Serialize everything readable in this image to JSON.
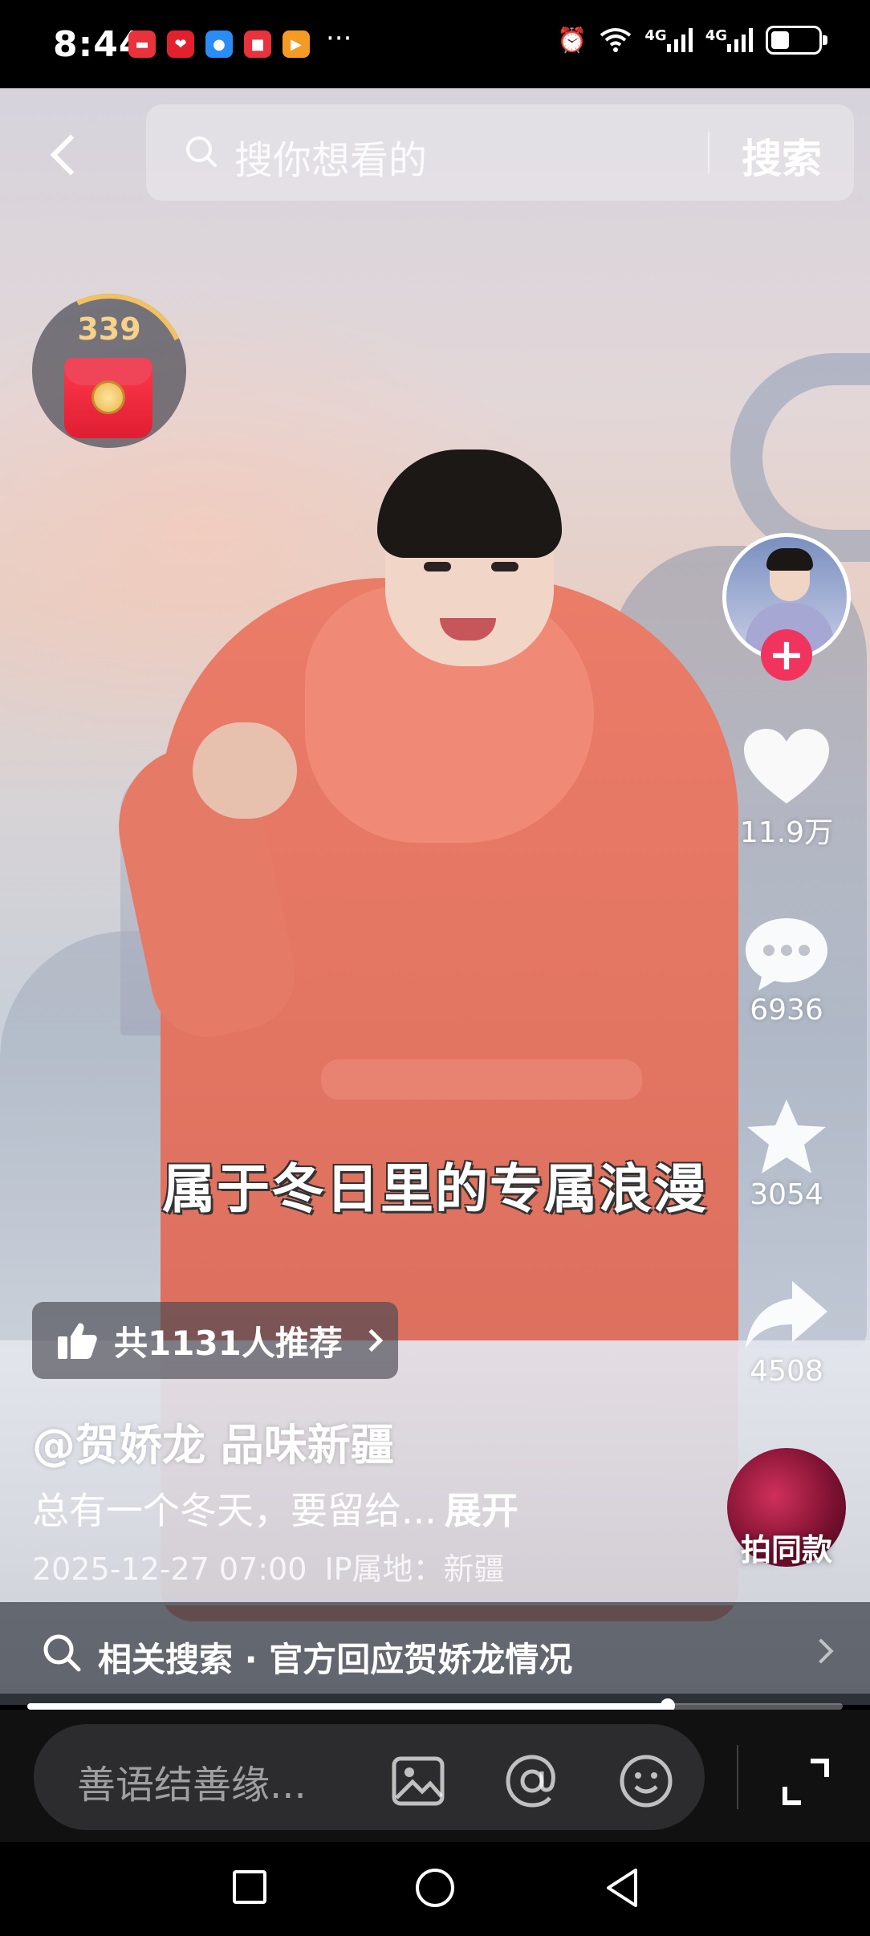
{
  "status_bar": {
    "time": "8:44",
    "notifications": [
      {
        "name": "huawei-app-icon",
        "color": "#e8323c",
        "glyph": "▬"
      },
      {
        "name": "heart-app-icon",
        "color": "#e3202d",
        "glyph": "❤"
      },
      {
        "name": "message-app-icon",
        "color": "#2a8cf5",
        "glyph": "●"
      },
      {
        "name": "red-app-icon",
        "color": "#e8323c",
        "glyph": "■"
      },
      {
        "name": "play-app-icon",
        "color": "#f59a23",
        "glyph": "▶"
      }
    ],
    "more": "···",
    "network_4g_1": "4G",
    "network_4g_2": "4G"
  },
  "search": {
    "placeholder": "搜你想看的",
    "button_label": "搜索"
  },
  "red_packet": {
    "count": "339"
  },
  "actions": {
    "likes": "11.9万",
    "comments": "6936",
    "favorites": "3054",
    "shares": "4508",
    "same_style_label": "拍同款"
  },
  "video": {
    "subtitle": "属于冬日里的专属浪漫",
    "recommend_label": "共1131人推荐",
    "author": "@贺娇龙 品味新疆",
    "caption": "总有一个冬天，要留给...",
    "expand_label": "展开",
    "date": "2025-12-27 07:00",
    "ip_location": "IP属地：新疆",
    "progress": 0.785
  },
  "related_search": {
    "text": "相关搜索 · 官方回应贺娇龙情况"
  },
  "comment_bar": {
    "placeholder": "善语结善缘..."
  },
  "colors": {
    "accent": "#f0345e",
    "coat": "#e37563"
  }
}
